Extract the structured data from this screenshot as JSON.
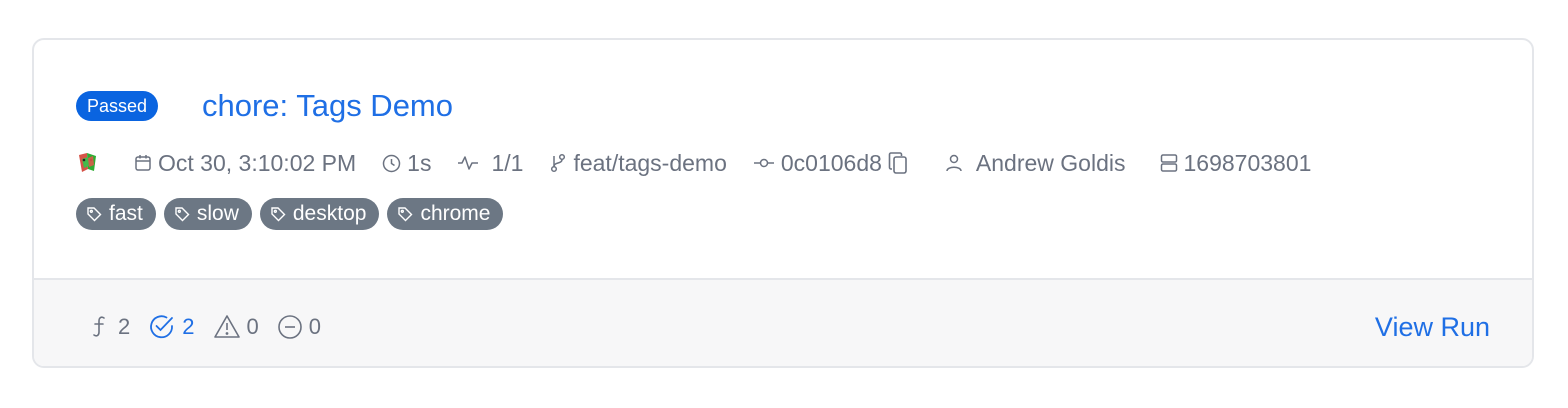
{
  "run": {
    "status": "Passed",
    "title": "chore: Tags Demo",
    "meta": {
      "date": "Oct 30, 3:10:02 PM",
      "duration": "1s",
      "attempts": "1/1",
      "branch": "feat/tags-demo",
      "commit": "0c0106d8",
      "author": "Andrew Goldis",
      "build_id": "1698703801"
    },
    "tags": [
      "fast",
      "slow",
      "desktop",
      "chrome"
    ]
  },
  "footer": {
    "flaky_count": "2",
    "passed_count": "2",
    "failed_count": "0",
    "skipped_count": "0",
    "view_run_label": "View Run"
  },
  "colors": {
    "accent": "#1f6fe5",
    "badge": "#0a64e0",
    "tag": "#6c7784",
    "muted": "#6b7280"
  },
  "icons": [
    "playwright-logo-icon",
    "calendar-icon",
    "clock-icon",
    "activity-icon",
    "branch-icon",
    "commit-icon",
    "copy-icon",
    "user-icon",
    "server-icon",
    "tag-icon",
    "flaky-icon",
    "check-circle-icon",
    "warning-icon",
    "minus-circle-icon"
  ]
}
